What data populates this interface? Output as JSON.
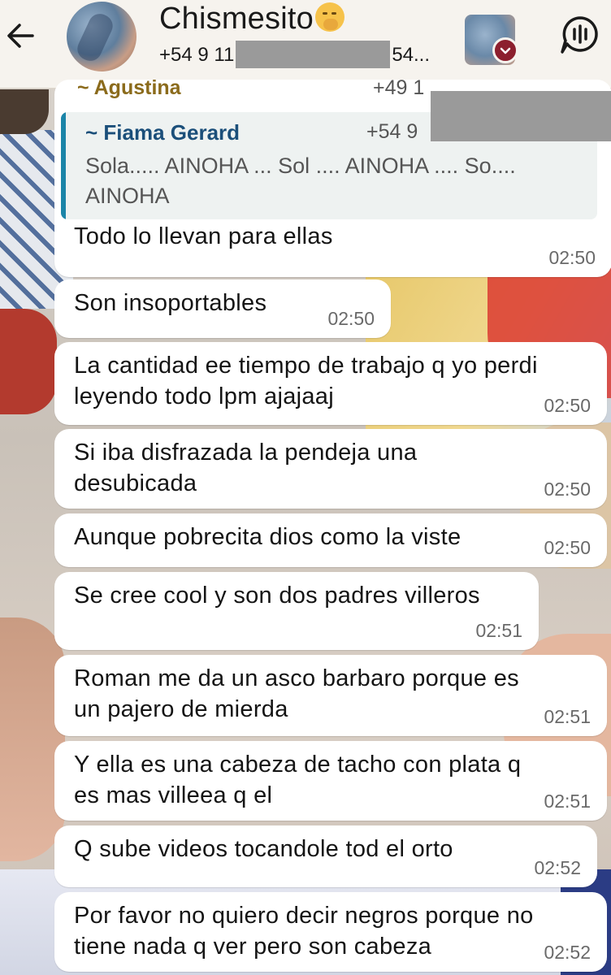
{
  "header": {
    "title": "Chismesito",
    "title_emoji": "face-with-hand-over-mouth-emoji",
    "phone_prefix": "+54 9 11",
    "phone_suffix": "54...",
    "accent_badge_color": "#8c1f2e"
  },
  "messages": [
    {
      "sender": "~ Agustina",
      "sender_phone": "+49 1",
      "quote": {
        "name": "~ Fiama Gerard",
        "phone": "+54 9",
        "text_line1": "Sola..... AINOHA ... Sol .... AINOHA .... So....",
        "text_line2": "AINOHA"
      },
      "text": "Todo lo llevan para ellas",
      "time": "02:50"
    },
    {
      "text": "Son insoportables",
      "time": "02:50"
    },
    {
      "text_line1": "La cantidad ee tiempo de trabajo q yo perdi",
      "text_line2": "leyendo todo lpm ajajaaj",
      "time": "02:50"
    },
    {
      "text_line1": "Si iba disfrazada la pendeja una",
      "text_line2": "desubicada",
      "time": "02:50"
    },
    {
      "text": "Aunque pobrecita dios como la viste",
      "time": "02:50"
    },
    {
      "text": "Se cree cool y son dos padres villeros",
      "time": "02:51"
    },
    {
      "text_line1": "Roman me da un asco barbaro porque es",
      "text_line2": "un pajero de mierda",
      "time": "02:51"
    },
    {
      "text_line1": "Y ella es una cabeza de tacho con plata q",
      "text_line2": "es mas villeea q el",
      "time": "02:51"
    },
    {
      "text": "Q sube videos tocandole tod el orto",
      "time": "02:52"
    },
    {
      "text_line1": "Por favor no quiero decir negros porque no",
      "text_line2": "tiene nada q ver pero son cabeza",
      "time": "02:52"
    }
  ]
}
